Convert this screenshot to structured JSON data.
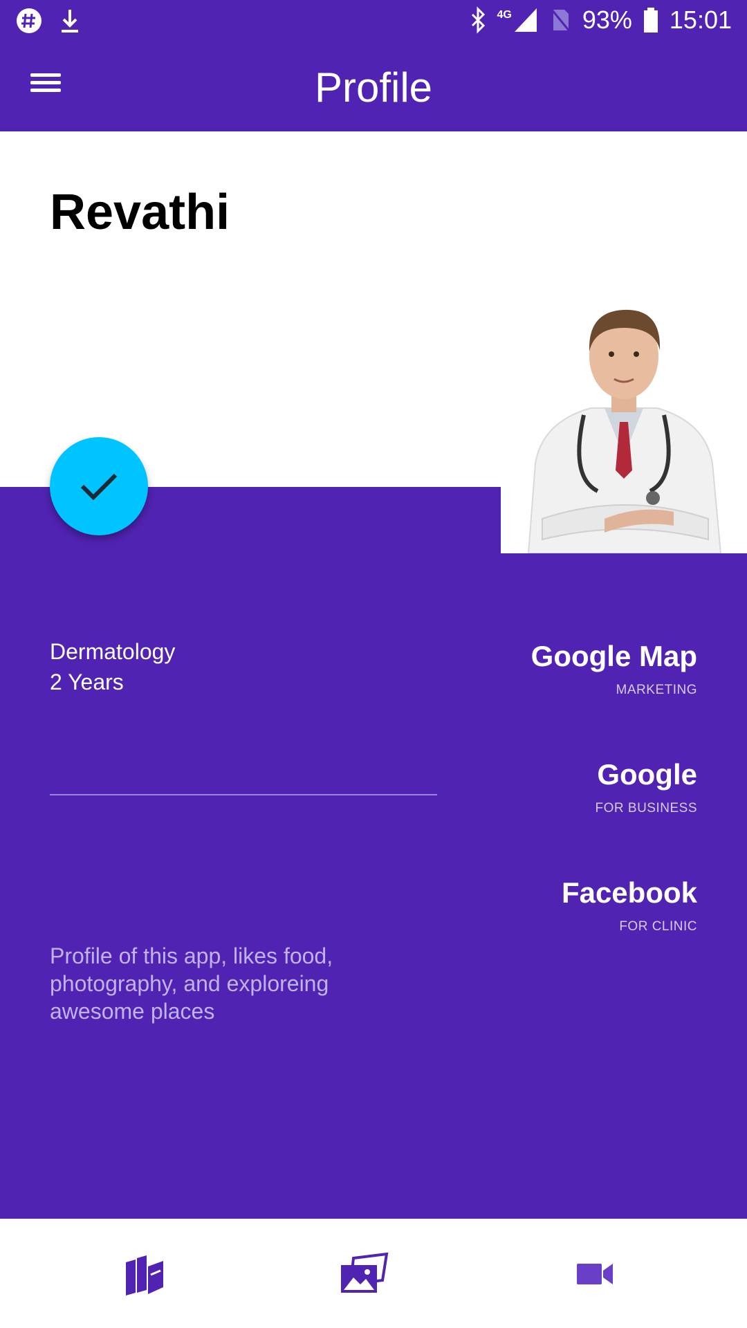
{
  "status_bar": {
    "battery": "93%",
    "time": "15:01",
    "network": "4G",
    "icons": [
      "hashtag-icon",
      "download-icon",
      "bluetooth-icon",
      "data-arrows-icon",
      "signal-icon",
      "no-sim-icon",
      "battery-icon"
    ]
  },
  "app_bar": {
    "title": "Profile",
    "menu_icon": "hamburger-menu-icon"
  },
  "profile": {
    "name": "Revathi",
    "specialty": "Dermatology",
    "experience": "2 Years",
    "bio": "Profile of this app, likes food, photography, and exploreing awesome places",
    "photo": "doctor-portrait"
  },
  "links": [
    {
      "title": "Google Map",
      "subtitle": "MARKETING"
    },
    {
      "title": "Google",
      "subtitle": "FOR BUSINESS"
    },
    {
      "title": "Facebook",
      "subtitle": "FOR CLINIC"
    }
  ],
  "bottom_nav": [
    "books-icon",
    "gallery-icon",
    "video-camera-icon"
  ],
  "colors": {
    "primary": "#5023b2",
    "accent": "#00c4ff",
    "bio_text": "#c2b2ec",
    "nav_icon": "#5023b2"
  }
}
